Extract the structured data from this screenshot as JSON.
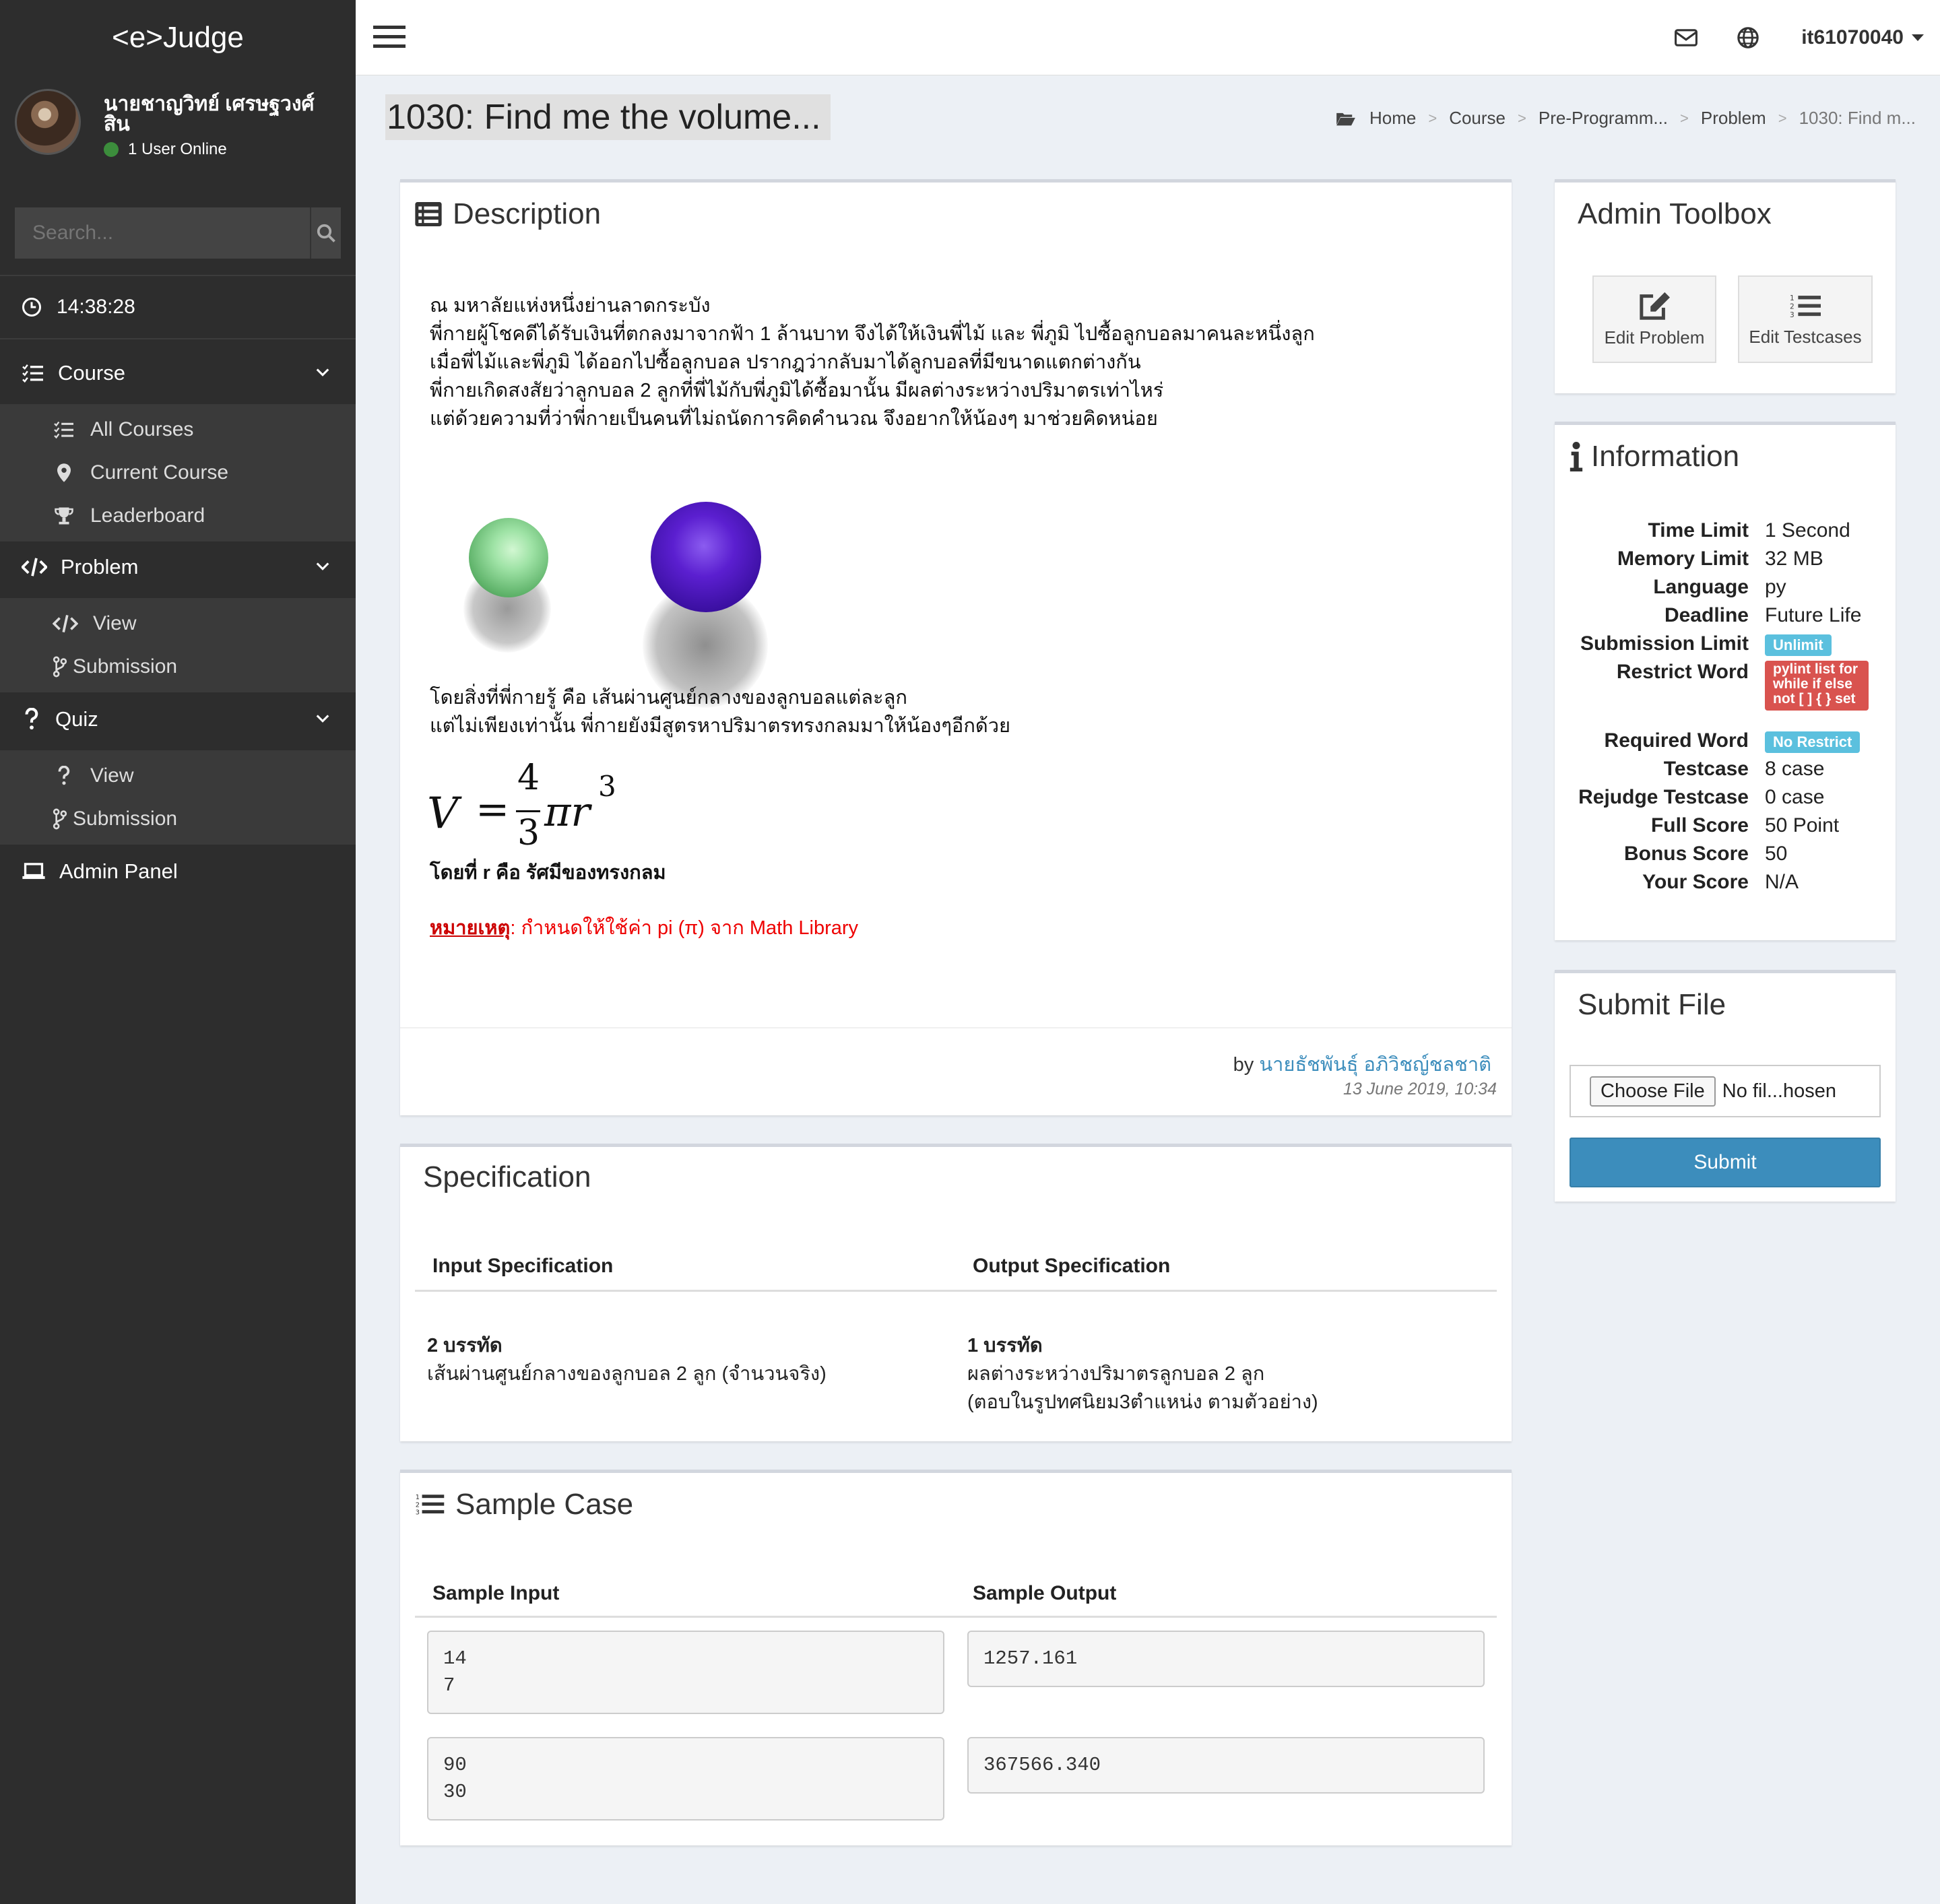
{
  "app": {
    "logo": "<e>Judge"
  },
  "user": {
    "name": "นายชาญวิทย์ เศรษฐวงศ์สิน",
    "online": "1 User Online",
    "account": "it61070040"
  },
  "search": {
    "placeholder": "Search..."
  },
  "clock": "14:38:28",
  "sidebar": {
    "course": {
      "label": "Course",
      "items": [
        "All Courses",
        "Current Course",
        "Leaderboard"
      ]
    },
    "problem": {
      "label": "Problem",
      "items": [
        "View",
        "Submission"
      ]
    },
    "quiz": {
      "label": "Quiz",
      "items": [
        "View",
        "Submission"
      ]
    },
    "admin": "Admin Panel"
  },
  "page": {
    "title": "1030: Find me the volume..."
  },
  "breadcrumb": [
    "Home",
    "Course",
    "Pre-Programm...",
    "Problem",
    "1030: Find m..."
  ],
  "description": {
    "title": "Description",
    "lines": [
      "ณ มหาลัยแห่งหนึ่งย่านลาดกระบัง",
      "พี่กายผู้โชคดีได้รับเงินที่ตกลงมาจากฟ้า 1 ล้านบาท จึงได้ให้เงินพี่ไม้ และ พี่ภูมิ ไปซื้อลูกบอลมาคนละหนึ่งลูก",
      "เมื่อพี่ไม้และพี่ภูมิ ได้ออกไปซื้อลูกบอล ปรากฎว่ากลับมาได้ลูกบอลที่มีขนาดแตกต่างกัน",
      "พี่กายเกิดสงสัยว่าลูกบอล 2 ลูกที่พี่ไม้กับพี่ภูมิได้ซื้อมานั้น มีผลต่างระหว่างปริมาตรเท่าไหร่",
      "แต่ด้วยความที่ว่าพี่กายเป็นคนที่ไม่ถนัดการคิดคำนวณ จึงอยากให้น้องๆ มาช่วยคิดหน่อย"
    ],
    "lines2": [
      "โดยสิ่งที่พี่กายรู้ คือ เส้นผ่านศูนย์กลางของลูกบอลแต่ละลูก",
      "แต่ไม่เพียงเท่านั้น พี่กายยังมีสูตรหาปริมาตรทรงกลมมาให้น้องๆอีกด้วย"
    ],
    "formula": {
      "lhs": "V",
      "eq": "=",
      "num": "4",
      "den": "3",
      "rest": "πr",
      "exp": "3"
    },
    "r_note": "โดยที่ r คือ รัศมีของทรงกลม",
    "note_label": "หมายเหตุ",
    "note_text": ": กำหนดให้ใช้ค่า pi (π) จาก Math Library",
    "author_prefix": "by",
    "author": "นายธัชพันธุ์ อภิวิชญ์ชลชาติ",
    "date": "13 June 2019, 10:34"
  },
  "specification": {
    "title": "Specification",
    "input_header": "Input Specification",
    "output_header": "Output Specification",
    "input_title": "2 บรรทัด",
    "input_desc": "เส้นผ่านศูนย์กลางของลูกบอล 2 ลูก (จำนวนจริง)",
    "output_title": "1 บรรทัด",
    "output_desc1": "ผลต่างระหว่างปริมาตรลูกบอล 2 ลูก",
    "output_desc2": "(ตอบในรูปทศนิยม3ตำแหน่ง ตามตัวอย่าง)"
  },
  "sample": {
    "title": "Sample Case",
    "input_header": "Sample Input",
    "output_header": "Sample Output",
    "cases": [
      {
        "input": "14\n7",
        "output": "1257.161"
      },
      {
        "input": "90\n30",
        "output": "367566.340"
      }
    ]
  },
  "admin_toolbox": {
    "title": "Admin Toolbox",
    "edit_problem": "Edit Problem",
    "edit_testcases": "Edit Testcases"
  },
  "information": {
    "title": "Information",
    "rows": [
      {
        "k": "Time Limit",
        "v": "1 Second"
      },
      {
        "k": "Memory Limit",
        "v": "32 MB"
      },
      {
        "k": "Language",
        "v": "py"
      },
      {
        "k": "Deadline",
        "v": "Future Life"
      },
      {
        "k": "Submission Limit",
        "badge": "Unlimit"
      },
      {
        "k": "Restrict Word",
        "badge": "pylint list for while if else not [ ] { } set"
      },
      {
        "k": "Required Word",
        "badge": "No Restrict"
      },
      {
        "k": "Testcase",
        "v": "8 case"
      },
      {
        "k": "Rejudge Testcase",
        "v": "0 case"
      },
      {
        "k": "Full Score",
        "v": "50 Point"
      },
      {
        "k": "Bonus Score",
        "v": "50"
      },
      {
        "k": "Your Score",
        "v": "N/A"
      }
    ],
    "colors": {
      "info": "#5bc0de",
      "danger": "#d9534f"
    }
  },
  "submit": {
    "title": "Submit File",
    "choose": "Choose File",
    "no_file": "No fil...hosen",
    "button": "Submit",
    "button_color": "#3c8dbc"
  }
}
